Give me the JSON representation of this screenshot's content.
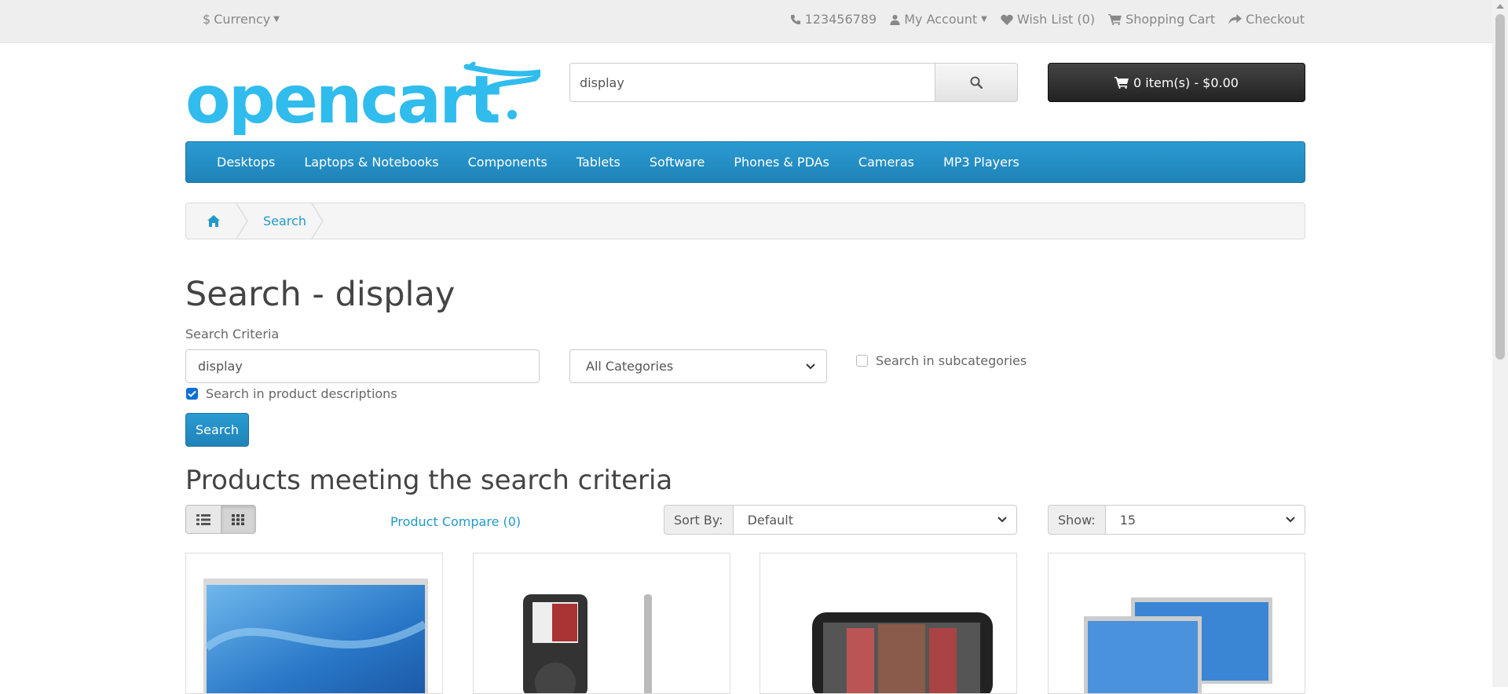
{
  "topbar": {
    "currency": "Currency",
    "currency_symbol": "$",
    "phone": "123456789",
    "my_account": "My Account",
    "wish_list": "Wish List (0)",
    "shopping_cart": "Shopping Cart",
    "checkout": "Checkout"
  },
  "header": {
    "logo_text": "opencart",
    "search_value": "display",
    "cart_label": "0 item(s) - $0.00"
  },
  "menu": [
    "Desktops",
    "Laptops & Notebooks",
    "Components",
    "Tablets",
    "Software",
    "Phones & PDAs",
    "Cameras",
    "MP3 Players"
  ],
  "breadcrumb": {
    "current": "Search"
  },
  "page": {
    "title": "Search - display",
    "criteria_label": "Search Criteria",
    "keyword_value": "display",
    "category_value": "All Categories",
    "subcategories_label": "Search in subcategories",
    "descriptions_label": "Search in product descriptions",
    "descriptions_checked": true,
    "subcategories_checked": false,
    "search_button": "Search",
    "results_heading": "Products meeting the search criteria"
  },
  "toolbar": {
    "compare": "Product Compare (0)",
    "sort_label": "Sort By:",
    "sort_value": "Default",
    "show_label": "Show:",
    "show_value": "15"
  },
  "colors": {
    "brand_blue": "#229ac8",
    "logo_blue": "#30bced"
  }
}
